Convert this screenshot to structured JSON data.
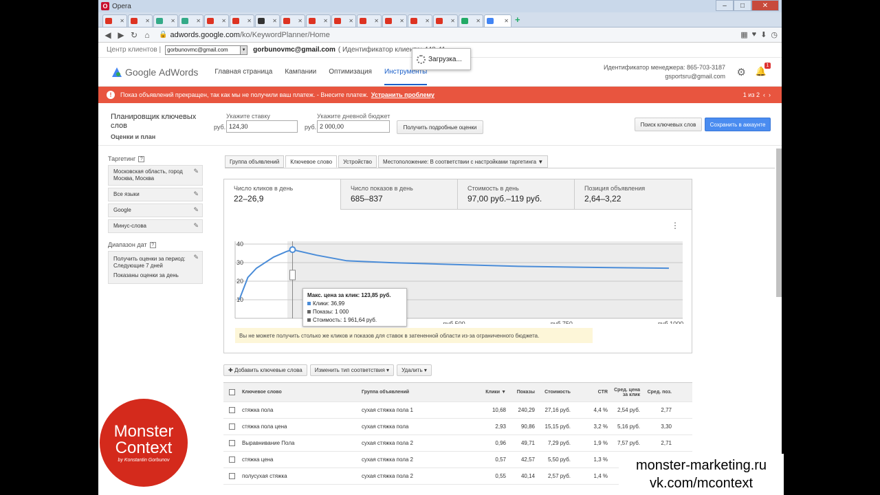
{
  "browser": {
    "app_name": "Opera",
    "url_prefix": "adwords.google.com",
    "url_rest": "/ko/KeywordPlanner/Home",
    "tabs": [
      {
        "color": "#d32"
      },
      {
        "color": "#d32"
      },
      {
        "color": "#3a8"
      },
      {
        "color": "#3a8"
      },
      {
        "color": "#d32"
      },
      {
        "color": "#d32"
      },
      {
        "color": "#333"
      },
      {
        "color": "#d32"
      },
      {
        "color": "#d32"
      },
      {
        "color": "#d32"
      },
      {
        "color": "#d32"
      },
      {
        "color": "#d32"
      },
      {
        "color": "#d32"
      },
      {
        "color": "#d32"
      },
      {
        "color": "#2a6"
      },
      {
        "color": "#4285f4"
      }
    ]
  },
  "client": {
    "label": "Центр клиентов |",
    "select_value": "gorbunovmc@gmail.com",
    "email": "gorbunovmc@gmail.com",
    "id_label": "( Идентификатор клиента: 448-41"
  },
  "loading": "Загрузка...",
  "header": {
    "logo_google": "Google",
    "logo_adwords": "AdWords",
    "nav": [
      "Главная страница",
      "Кампании",
      "Оптимизация",
      "Инструменты"
    ],
    "manager_id": "Идентификатор менеджера: 865-703-3187",
    "manager_email": "gsportsru@gmail.com",
    "notif_count": "1"
  },
  "alert": {
    "text": "Показ объявлений прекращен, так как мы не получили ваш платеж. - Внесите платеж.",
    "fix": "Устранить проблему",
    "pager": "1 из 2"
  },
  "planner": {
    "title": "Планировщик ключевых слов",
    "subtitle": "Оценки и план",
    "bid_label": "Укажите ставку",
    "bid_prefix": "руб.",
    "bid_value": "124,30",
    "budget_label": "Укажите дневной бюджет",
    "budget_prefix": "руб.",
    "budget_value": "2 000,00",
    "get_estimates": "Получить подробные оценки",
    "search_keywords": "Поиск ключевых слов",
    "save_to_account": "Сохранить в аккаунте"
  },
  "sidebar": {
    "targeting_label": "Таргетинг",
    "targeting_items": [
      "Московская область, город Москва, Москва",
      "Все языки",
      "Google",
      "Минус-слова"
    ],
    "date_label": "Диапазон дат",
    "date_text1": "Получить оценки за период: Следующие 7 дней",
    "date_text2": "Показаны оценки за день"
  },
  "subtabs": [
    "Группа объявлений",
    "Ключевое слово",
    "Устройство",
    "Местоположение: В соответствии с настройками таргетинга"
  ],
  "metrics": [
    {
      "label": "Число кликов в день",
      "value": "22–26,9"
    },
    {
      "label": "Число показов в день",
      "value": "685–837"
    },
    {
      "label": "Стоимость в день",
      "value": "97,00 руб.–119 руб."
    },
    {
      "label": "Позиция объявления",
      "value": "2,64–3,22"
    }
  ],
  "chart_data": {
    "type": "line",
    "y_ticks": [
      "40",
      "30",
      "20",
      "10"
    ],
    "x_ticks": [
      "руб.250",
      "руб.500",
      "руб.750",
      "руб.1000"
    ],
    "ylim": [
      0,
      40
    ],
    "series": [
      {
        "x": [
          0,
          20,
          40,
          80,
          110,
          124,
          180,
          250,
          350,
          500,
          650,
          800,
          1000
        ],
        "values": [
          10,
          22,
          27,
          33,
          36,
          37,
          34,
          31,
          30,
          29,
          28,
          27.5,
          27
        ]
      }
    ]
  },
  "tooltip": {
    "title": "Макс. цена за клик: 123,85 руб.",
    "clicks": "Клики: 36,99",
    "impr": "Показы: 1 000",
    "cost": "Стоимость: 1 961,64 руб."
  },
  "notice": "Вы не можете получить столько же кликов и показов для ставок в затененной области из-за ограниченного бюджета.",
  "toolbar": {
    "add": "Добавить ключевые слова",
    "match": "Изменить тип соответствия",
    "remove": "Удалить"
  },
  "table": {
    "headers": [
      "Ключевое слово",
      "Группа объявлений",
      "Клики",
      "Показы",
      "Стоимость",
      "CTR",
      "Сред. цена за клик",
      "Сред. поз."
    ],
    "rows": [
      [
        "стяжка пола",
        "сухая стяжка пола 1",
        "10,68",
        "240,29",
        "27,16 руб.",
        "4,4 %",
        "2,54 руб.",
        "2,77"
      ],
      [
        "стяжка пола цена",
        "сухая стяжка пола",
        "2,93",
        "90,86",
        "15,15 руб.",
        "3,2 %",
        "5,16 руб.",
        "3,30"
      ],
      [
        "Выравнивание Пола",
        "сухая стяжка пола 2",
        "0,96",
        "49,71",
        "7,29 руб.",
        "1,9 %",
        "7,57 руб.",
        "2,71"
      ],
      [
        "стяжка цена",
        "сухая стяжка пола 2",
        "0,57",
        "42,57",
        "5,50 руб.",
        "1,3 %",
        "",
        ""
      ],
      [
        "полусухая стяжка",
        "сухая стяжка пола 2",
        "0,55",
        "40,14",
        "2,57 руб.",
        "1,4 %",
        "",
        ""
      ]
    ]
  },
  "watermark": {
    "logo1": "Monster",
    "logo2": "Context",
    "logo3": "by Konstantin Gorbunov",
    "site1": "monster-marketing.ru",
    "site2": "vk.com/mcontext"
  }
}
